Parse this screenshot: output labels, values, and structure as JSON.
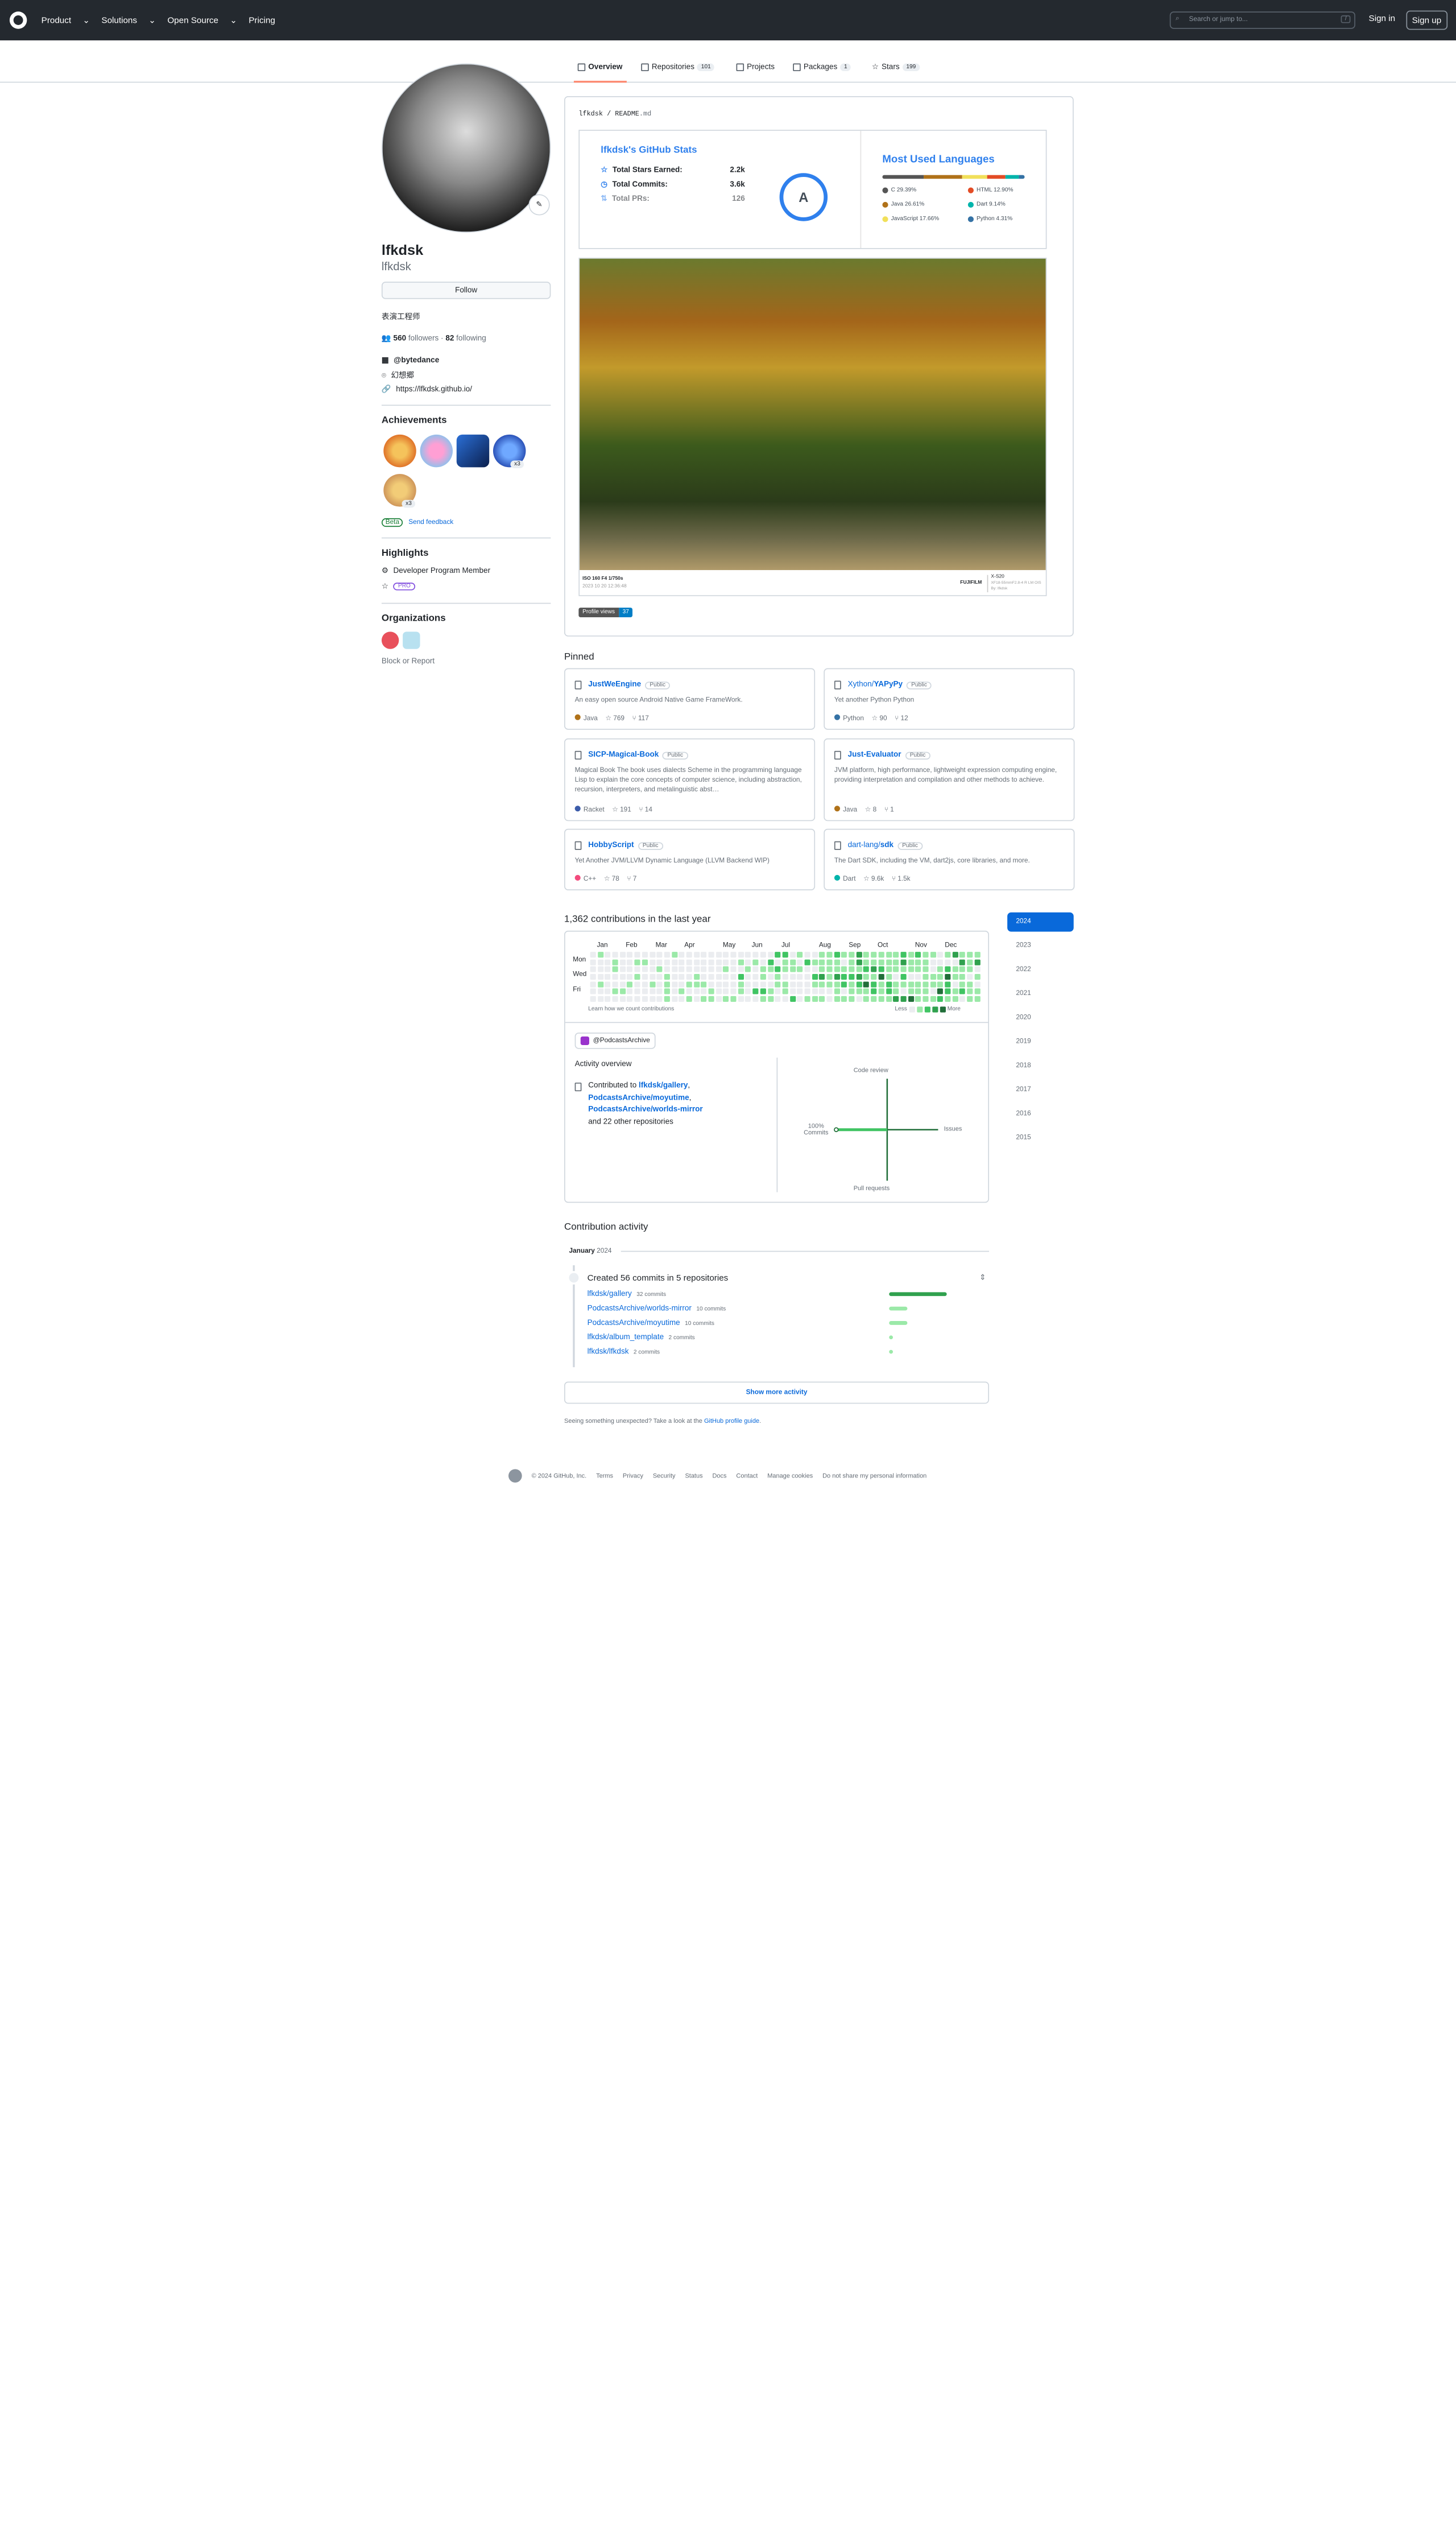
{
  "header": {
    "nav": [
      "Product",
      "Solutions",
      "Open Source",
      "Pricing"
    ],
    "search_placeholder": "Search or jump to...",
    "search_kbd": "/",
    "sign_in": "Sign in",
    "sign_up": "Sign up"
  },
  "tabs": [
    {
      "label": "Overview",
      "count": ""
    },
    {
      "label": "Repositories",
      "count": "101"
    },
    {
      "label": "Projects",
      "count": ""
    },
    {
      "label": "Packages",
      "count": "1"
    },
    {
      "label": "Stars",
      "count": "199"
    }
  ],
  "profile": {
    "name": "lfkdsk",
    "login": "lfkdsk",
    "follow_label": "Follow",
    "bio": "表演工程师",
    "followers": "560",
    "followers_label": "followers",
    "dot": "·",
    "following": "82",
    "following_label": "following",
    "company": "@bytedance",
    "location": "幻想郷",
    "website": "https://lfkdsk.github.io/"
  },
  "achievements": {
    "title": "Achievements",
    "x3a": "x3",
    "x3b": "x3",
    "beta": "Beta",
    "feedback": "Send feedback"
  },
  "highlights": {
    "title": "Highlights",
    "member": "Developer Program Member",
    "pro": "PRO"
  },
  "organizations": {
    "title": "Organizations",
    "block": "Block or Report"
  },
  "readme": {
    "path_user": "lfkdsk",
    "path_sep": "/",
    "path_file": "README",
    "path_ext": ".md",
    "stats_title": "lfkdsk's GitHub Stats",
    "stats": [
      {
        "label": "Total Stars Earned:",
        "value": "2.2k"
      },
      {
        "label": "Total Commits:",
        "value": "3.6k"
      },
      {
        "label": "Total PRs:",
        "value": "126"
      }
    ],
    "rank": "A",
    "lang_title": "Most Used Languages",
    "languages": [
      {
        "name": "C 29.39%",
        "color": "#555555",
        "pct": 29.39
      },
      {
        "name": "Java 26.61%",
        "color": "#b07219",
        "pct": 26.61
      },
      {
        "name": "JavaScript 17.66%",
        "color": "#f1e05a",
        "pct": 17.66
      },
      {
        "name": "HTML 12.90%",
        "color": "#e34c26",
        "pct": 12.9
      },
      {
        "name": "Dart 9.14%",
        "color": "#00b4ab",
        "pct": 9.14
      },
      {
        "name": "Python 4.31%",
        "color": "#3572a5",
        "pct": 4.31
      }
    ],
    "photo_exif": "ISO 160 F4 1/750s",
    "photo_date": "2023 10 20 12:36:48",
    "photo_brand": "FUJIFILM",
    "photo_model": "X-S20",
    "photo_lens": "XF18-55mmF2.8-4 R LM OIS",
    "photo_by": "By: lfkdsk",
    "views_label": "Profile views",
    "views": "37"
  },
  "pinned": {
    "title": "Pinned",
    "public": "Public",
    "cards": [
      {
        "owner": "",
        "name": "JustWeEngine",
        "desc": "An easy open source Android Native Game FrameWork.",
        "lang": "Java",
        "lang_color": "#b07219",
        "stars": "769",
        "forks": "117"
      },
      {
        "owner": "Xython/",
        "name": "YAPyPy",
        "desc": "Yet another Python Python",
        "lang": "Python",
        "lang_color": "#3572a5",
        "stars": "90",
        "forks": "12"
      },
      {
        "owner": "",
        "name": "SICP-Magical-Book",
        "desc": "Magical Book The book uses dialects Scheme in the programming language Lisp to explain the core concepts of computer science, including abstraction, recursion, interpreters, and metalinguistic abst…",
        "lang": "Racket",
        "lang_color": "#3c5caa",
        "stars": "191",
        "forks": "14"
      },
      {
        "owner": "",
        "name": "Just-Evaluator",
        "desc": "JVM platform, high performance, lightweight expression computing engine, providing interpretation and compilation and other methods to achieve.",
        "lang": "Java",
        "lang_color": "#b07219",
        "stars": "8",
        "forks": "1"
      },
      {
        "owner": "",
        "name": "HobbyScript",
        "desc": "Yet Another JVM/LLVM Dynamic Language (LLVM Backend WIP)",
        "lang": "C++",
        "lang_color": "#f34b7d",
        "stars": "78",
        "forks": "7"
      },
      {
        "owner": "dart-lang/",
        "name": "sdk",
        "desc": "The Dart SDK, including the VM, dart2js, core libraries, and more.",
        "lang": "Dart",
        "lang_color": "#00b4ab",
        "stars": "9.6k",
        "forks": "1.5k"
      }
    ]
  },
  "contributions": {
    "title": "1,362 contributions in the last year",
    "months": [
      "Jan",
      "Feb",
      "Mar",
      "Apr",
      "May",
      "Jun",
      "Jul",
      "Aug",
      "Sep",
      "Oct",
      "Nov",
      "Dec"
    ],
    "days": [
      "Mon",
      "Wed",
      "Fri"
    ],
    "learn": "Learn how we count contributions",
    "less": "Less",
    "more": "More",
    "org": "@PodcastsArchive",
    "years": [
      "2024",
      "2023",
      "2022",
      "2021",
      "2020",
      "2019",
      "2018",
      "2017",
      "2016",
      "2015"
    ],
    "activity_title": "Activity overview",
    "contributed": "Contributed to",
    "repo1": "lfkdsk/gallery",
    "repo2": "PodcastsArchive/moyutime",
    "repo3": "PodcastsArchive/worlds-mirror",
    "comma": ",",
    "others": "and 22 other repositories",
    "axis": {
      "top": "Code review",
      "right": "Issues",
      "bottom": "Pull requests",
      "left_pct": "100%",
      "left": "Commits"
    },
    "overview_values": {
      "commits": 100,
      "issues": 0,
      "pull_requests": 0,
      "code_review": 0
    }
  },
  "activity": {
    "title": "Contribution activity",
    "month": "January",
    "year": "2024",
    "created": "Created 56 commits in 5 repositories",
    "repos": [
      {
        "name": "lfkdsk/gallery",
        "commits": "32 commits",
        "count": 32
      },
      {
        "name": "PodcastsArchive/worlds-mirror",
        "commits": "10 commits",
        "count": 10
      },
      {
        "name": "PodcastsArchive/moyutime",
        "commits": "10 commits",
        "count": 10
      },
      {
        "name": "lfkdsk/album_template",
        "commits": "2 commits",
        "count": 2
      },
      {
        "name": "lfkdsk/lfkdsk",
        "commits": "2 commits",
        "count": 2
      }
    ],
    "show_more": "Show more activity",
    "unexpected": "Seeing something unexpected? Take a look at the",
    "guide": "GitHub profile guide",
    "period": "."
  },
  "footer": [
    "© 2024 GitHub, Inc.",
    "Terms",
    "Privacy",
    "Security",
    "Status",
    "Docs",
    "Contact",
    "Manage cookies",
    "Do not share my personal information"
  ],
  "colors": {
    "accent": "#0969da",
    "green1": "#9be9a8",
    "green2": "#40c463",
    "green3": "#30a14e",
    "green4": "#216e39",
    "empty": "#ebedf0"
  }
}
